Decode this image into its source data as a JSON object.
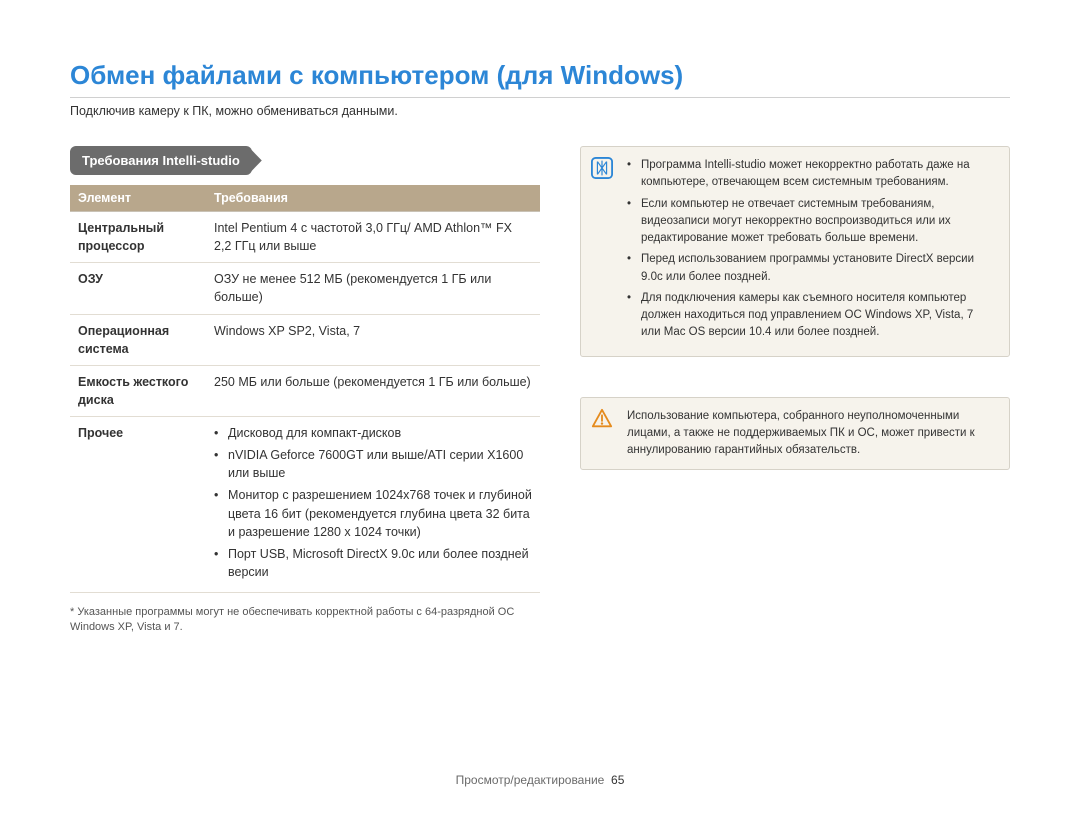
{
  "header": {
    "title": "Обмен файлами с компьютером (для Windows)",
    "subtitle": "Подключив камеру к ПК, можно обмениваться данными."
  },
  "requirements": {
    "badge": "Требования Intelli-studio",
    "columns": {
      "element": "Элемент",
      "requirement": "Требования"
    },
    "rows": {
      "cpu": {
        "label": "Центральный процессор",
        "value": "Intel Pentium 4 с частотой 3,0 ГГц/ AMD Athlon™ FX 2,2 ГГц или выше"
      },
      "ram": {
        "label": "ОЗУ",
        "value": "ОЗУ не менее 512 МБ (рекомендуется 1 ГБ или больше)"
      },
      "os": {
        "label": "Операционная система",
        "value": "Windows XP SP2, Vista, 7"
      },
      "hdd": {
        "label": "Емкость жесткого диска",
        "value": "250 МБ или больше (рекомендуется 1 ГБ или больше)"
      },
      "misc": {
        "label": "Прочее",
        "items": [
          "Дисковод для компакт-дисков",
          "nVIDIA Geforce 7600GT или выше/ATI серии X1600 или выше",
          "Монитор с разрешением 1024x768 точек и глубиной цвета 16 бит (рекомендуется глубина цвета 32 бита и разрешение 1280 x 1024 точки)",
          "Порт USB, Microsoft DirectX 9.0c или более поздней версии"
        ]
      }
    },
    "footnote": "* Указанные программы могут не обеспечивать корректной работы с 64-разрядной ОС Windows XP, Vista и 7."
  },
  "note": {
    "items": [
      "Программа Intelli-studio может некорректно работать даже на компьютере, отвечающем всем системным требованиям.",
      "Если компьютер не отвечает системным требованиям, видеозаписи могут некорректно воспроизводиться или их редактирование может требовать больше времени.",
      "Перед использованием программы установите DirectX версии 9.0c или более поздней.",
      "Для подключения камеры как съемного носителя компьютер должен находиться под управлением ОС Windows XP, Vista, 7 или Mac OS версии 10.4 или более поздней."
    ]
  },
  "warning": {
    "text": "Использование компьютера, собранного неуполномоченными лицами, а также не поддерживаемых ПК и ОС, может привести к аннулированию гарантийных обязательств."
  },
  "footer": {
    "section": "Просмотр/редактирование",
    "page": "65"
  }
}
